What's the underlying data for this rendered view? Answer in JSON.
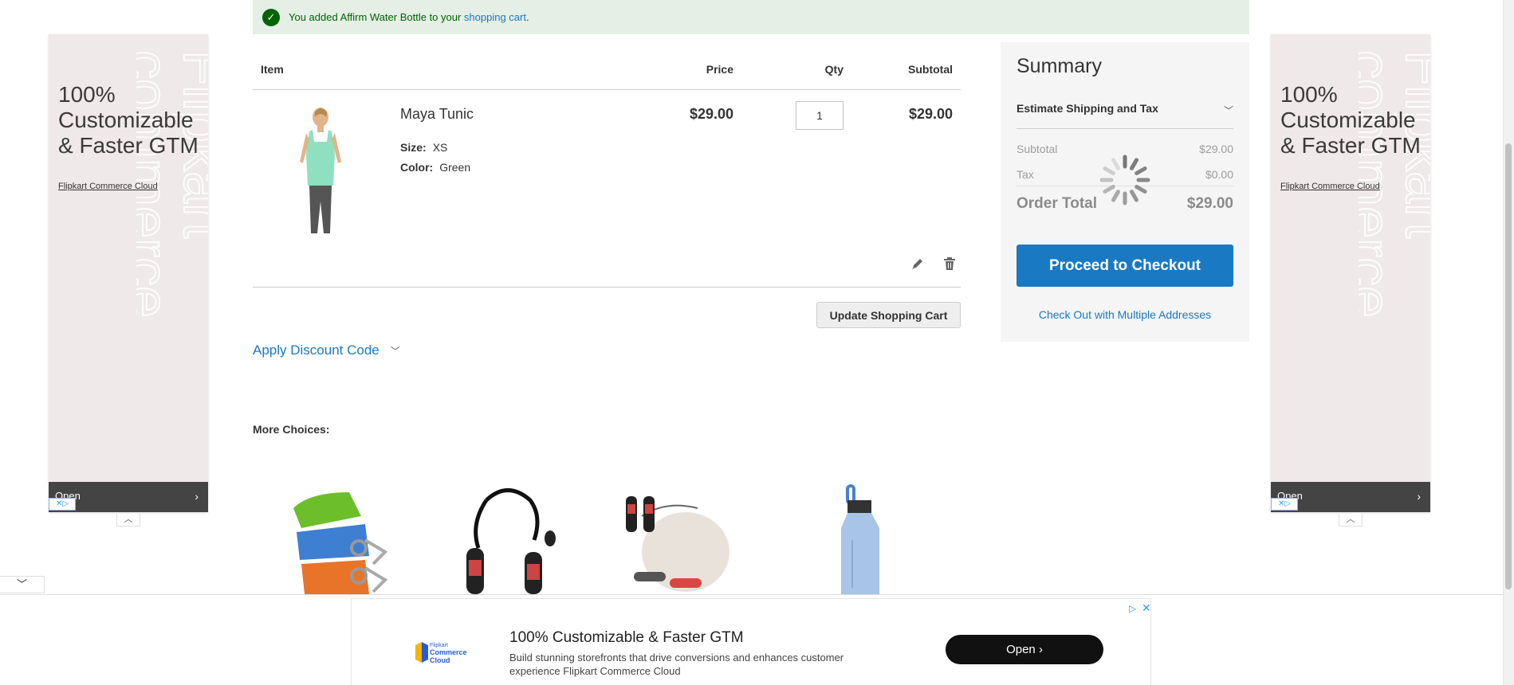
{
  "message": {
    "prefix": "You added Affirm Water Bottle to your ",
    "link": "shopping cart",
    "suffix": "."
  },
  "cart": {
    "headers": {
      "item": "Item",
      "price": "Price",
      "qty": "Qty",
      "subtotal": "Subtotal"
    },
    "item": {
      "name": "Maya Tunic",
      "size_label": "Size:",
      "size_value": "XS",
      "color_label": "Color:",
      "color_value": "Green",
      "price": "$29.00",
      "qty": "1",
      "subtotal": "$29.00"
    },
    "update_label": "Update Shopping Cart",
    "discount_label": "Apply Discount Code"
  },
  "more_choices": {
    "title": "More Choices:",
    "items": [
      "yoga-strap",
      "jump-rope",
      "jump-rope-kit",
      "water-bottle"
    ]
  },
  "summary": {
    "title": "Summary",
    "estimate_label": "Estimate Shipping and Tax",
    "subtotal_label": "Subtotal",
    "subtotal_value": "$29.00",
    "tax_label": "Tax",
    "tax_value": "$0.00",
    "total_label": "Order Total",
    "total_value": "$29.00",
    "checkout_label": "Proceed to Checkout",
    "multi_label": "Check Out with Multiple Addresses"
  },
  "side_ad": {
    "headline": "100% Customizable & Faster GTM",
    "brand": "Flipkart Commerce Cloud",
    "open": "Open"
  },
  "dock_ad": {
    "title": "100% Customizable & Faster GTM",
    "description": "Build stunning storefronts that drive conversions and enhances customer experience Flipkart Commerce Cloud",
    "open": "Open",
    "logo_line1": "Flipkart",
    "logo_line2": "Commerce",
    "logo_line3": "Cloud"
  },
  "colors": {
    "accent": "#1979c3",
    "success_bg": "#e5efe5",
    "success_text": "#006400",
    "summary_bg": "#f5f5f5"
  }
}
